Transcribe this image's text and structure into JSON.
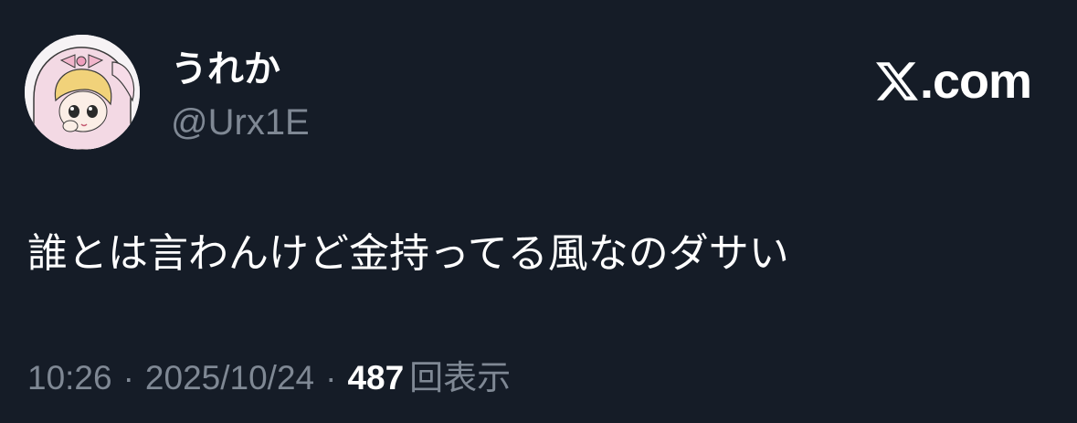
{
  "author": {
    "display_name": "うれか",
    "handle": "@Urx1E",
    "avatar_icon": "avatar-illustration-icon"
  },
  "brand": {
    "logo_icon": "x-logo-icon",
    "text": ".com"
  },
  "tweet": {
    "text": "誰とは言わんけど金持ってる風なのダサい"
  },
  "meta": {
    "time": "10:26",
    "separator": "·",
    "date": "2025/10/24",
    "views_count": "487",
    "views_label": "回表示"
  },
  "colors": {
    "background": "#151c27",
    "primary_text": "#ffffff",
    "secondary_text": "#7f8894"
  }
}
